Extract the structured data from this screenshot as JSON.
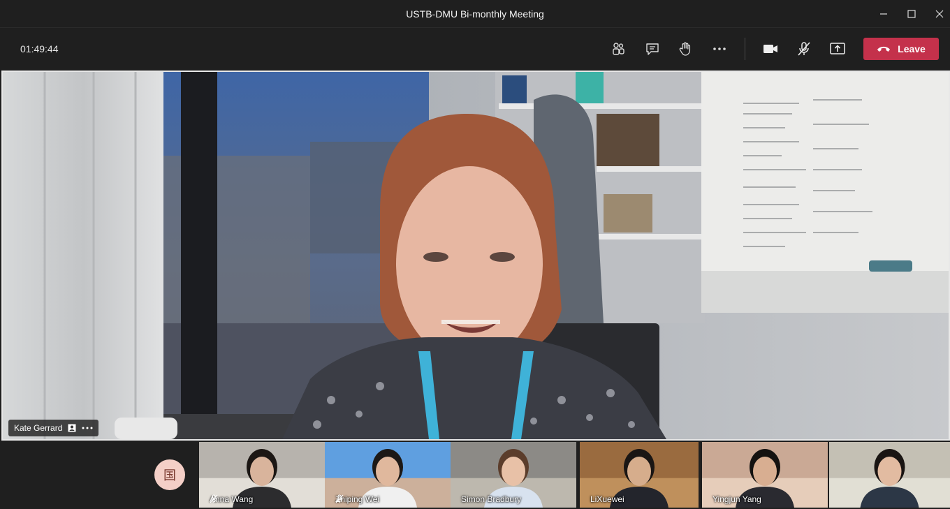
{
  "window": {
    "title": "USTB-DMU Bi-monthly Meeting"
  },
  "toolbar": {
    "timer": "01:49:44",
    "leave_label": "Leave"
  },
  "main_video": {
    "participant": "Kate Gerrard"
  },
  "avatar": {
    "initial": "国"
  },
  "participants": [
    {
      "name": "Anna Wang",
      "muted": true
    },
    {
      "name": "Zhiping Wei",
      "muted": true
    },
    {
      "name": "Simon Bradbury",
      "muted": false
    },
    {
      "name": "LiXuewei",
      "muted": false
    },
    {
      "name": "Yingjun Yang",
      "muted": false
    },
    {
      "name": "",
      "muted": false
    }
  ],
  "colors": {
    "leave": "#c4314b",
    "background": "#1f1f1f"
  }
}
